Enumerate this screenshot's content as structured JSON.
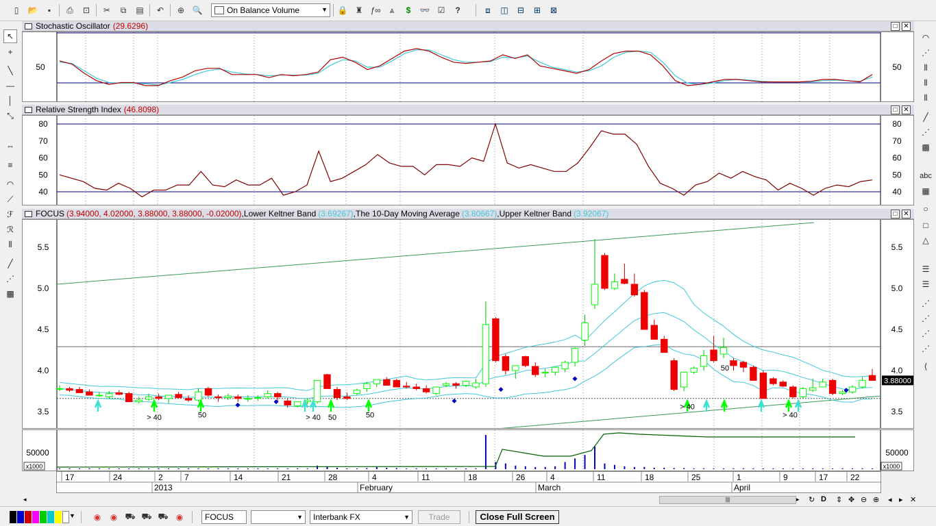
{
  "toolbar": {
    "indicator_selected": "On Balance Volume",
    "icons": [
      "new-icon",
      "open-icon",
      "save-icon",
      "print-icon",
      "print-preview-icon",
      "cut-icon",
      "copy-icon",
      "paste-icon",
      "undo-icon",
      "crosshair-icon",
      "zoom-icon",
      "indicator-icon",
      "expert-icon",
      "function-icon",
      "chart-icon",
      "dollar-icon",
      "binoculars-icon",
      "properties-icon",
      "help-icon",
      "window-cascade-icon",
      "tile-vertical-icon",
      "tile-horizontal-icon",
      "tile-grid-icon",
      "layout-icon"
    ]
  },
  "panes": {
    "stochastic": {
      "name": "Stochastic Oscillator",
      "value": "(29.6296)",
      "y_labels": [
        "50"
      ],
      "y_label_right": "50"
    },
    "rsi": {
      "name": "Relative Strength Index",
      "value": "(46.8098)",
      "y_labels": [
        "80",
        "70",
        "60",
        "50",
        "40"
      ]
    },
    "price": {
      "symbol": "FOCUS",
      "ohlc": "(3.94000, 4.02000, 3.88000, 3.88000, -0.02000)",
      "lower_band_label": "Lower Keltner Band",
      "lower_band_value": "(3.69267)",
      "ma_label": "The 10-Day Moving Average",
      "ma_value": "(3.80667)",
      "upper_band_label": "Upper Keltner Band",
      "upper_band_value": "(3.92067)",
      "sep1": ", ",
      "sep2": ", ",
      "y_labels": [
        "5.5",
        "5.0",
        "4.5",
        "4.0",
        "3.5"
      ],
      "last_price": "3.88000",
      "annotations": [
        "> 40",
        "50",
        "> 40",
        "50",
        "50",
        "> 40",
        "50",
        "> 40"
      ]
    },
    "volume": {
      "y_label": "50000",
      "multiplier": "x1000"
    }
  },
  "date_axis": {
    "days": [
      "17",
      "24",
      "2",
      "7",
      "14",
      "21",
      "28",
      "4",
      "11",
      "18",
      "26",
      "4",
      "11",
      "18",
      "25",
      "1",
      "9",
      "17",
      "22"
    ],
    "months": [
      "2013",
      "February",
      "March",
      "April"
    ]
  },
  "bottom_bar": {
    "symbol": "FOCUS",
    "period": "",
    "data_source": "Interbank FX",
    "trade_label": "Trade",
    "close_full_screen": "Close Full Screen"
  },
  "colors": {
    "candle_up": "#00ff00",
    "candle_down": "#ee0000",
    "band": "#40c8d8",
    "stoch_k": "#b00000",
    "stoch_d": "#40c8d8",
    "rsi": "#800000",
    "trendline": "#3a9a5a",
    "volume": "#0000c0",
    "obv": "#006000"
  },
  "chart_data": [
    {
      "type": "line",
      "title": "Stochastic Oscillator",
      "series": [
        {
          "name": "Stochastic Oscillator",
          "values": [
            60,
            55,
            40,
            28,
            22,
            25,
            25,
            20,
            20,
            28,
            34,
            44,
            48,
            48,
            38,
            38,
            38,
            33,
            38,
            36,
            38,
            42,
            62,
            66,
            58,
            46,
            52,
            64,
            76,
            80,
            76,
            66,
            58,
            56,
            58,
            60,
            70,
            64,
            70,
            52,
            48,
            44,
            40,
            46,
            60,
            72,
            76,
            76,
            70,
            52,
            28,
            20,
            22,
            26,
            30,
            30,
            28,
            26,
            26,
            26,
            26,
            27,
            30,
            30,
            28,
            26,
            38
          ]
        },
        {
          "name": "%D",
          "values": [
            58,
            56,
            44,
            32,
            25,
            24,
            24,
            23,
            21,
            25,
            30,
            38,
            44,
            47,
            42,
            39,
            38,
            36,
            37,
            37,
            37,
            40,
            53,
            62,
            60,
            50,
            50,
            60,
            72,
            78,
            78,
            70,
            62,
            58,
            58,
            59,
            66,
            65,
            68,
            58,
            50,
            46,
            42,
            44,
            52,
            66,
            74,
            76,
            74,
            58,
            36,
            24,
            22,
            24,
            28,
            30,
            29,
            27,
            26,
            26,
            26,
            26,
            28,
            29,
            28,
            27,
            34
          ]
        }
      ]
    },
    {
      "type": "line",
      "title": "Relative Strength Index",
      "ylim": [
        36,
        82
      ],
      "series": [
        {
          "name": "Relative Strength Index",
          "values": [
            50,
            48,
            46,
            42,
            41,
            45,
            42,
            37,
            41,
            41,
            44,
            44,
            52,
            44,
            43,
            47,
            44,
            44,
            48,
            38,
            40,
            44,
            64,
            46,
            48,
            52,
            56,
            62,
            57,
            55,
            55,
            50,
            56,
            56,
            55,
            60,
            58,
            80,
            57,
            54,
            56,
            54,
            52,
            52,
            57,
            66,
            76,
            74,
            74,
            68,
            55,
            45,
            42,
            38,
            44,
            46,
            51,
            48,
            52,
            49,
            47,
            41,
            45,
            42,
            38,
            42,
            44,
            43,
            46,
            47
          ]
        }
      ]
    },
    {
      "type": "candlestick",
      "title": "FOCUS",
      "ylim": [
        3.25,
        5.8
      ],
      "series": [
        {
          "name": "FOCUS",
          "values": [
            [
              3.78,
              3.82,
              3.75,
              3.78
            ],
            [
              3.78,
              3.8,
              3.74,
              3.76
            ],
            [
              3.77,
              3.8,
              3.73,
              3.73
            ],
            [
              3.74,
              3.77,
              3.7,
              3.7
            ],
            [
              3.7,
              3.74,
              3.68,
              3.7
            ],
            [
              3.68,
              3.75,
              3.66,
              3.72
            ],
            [
              3.73,
              3.76,
              3.7,
              3.71
            ],
            [
              3.72,
              3.74,
              3.62,
              3.62
            ],
            [
              3.62,
              3.68,
              3.6,
              3.64
            ],
            [
              3.65,
              3.72,
              3.63,
              3.68
            ],
            [
              3.68,
              3.72,
              3.64,
              3.66
            ],
            [
              3.66,
              3.7,
              3.6,
              3.7
            ],
            [
              3.71,
              3.74,
              3.66,
              3.67
            ],
            [
              3.66,
              3.7,
              3.62,
              3.64
            ],
            [
              3.64,
              3.78,
              3.62,
              3.74
            ],
            [
              3.78,
              3.8,
              3.68,
              3.7
            ],
            [
              3.68,
              3.71,
              3.62,
              3.67
            ],
            [
              3.67,
              3.72,
              3.64,
              3.69
            ],
            [
              3.68,
              3.71,
              3.62,
              3.66
            ],
            [
              3.66,
              3.7,
              3.62,
              3.66
            ],
            [
              3.67,
              3.7,
              3.63,
              3.67
            ],
            [
              3.68,
              3.76,
              3.66,
              3.72
            ],
            [
              3.72,
              3.74,
              3.62,
              3.68
            ],
            [
              3.63,
              3.66,
              3.55,
              3.58
            ],
            [
              3.57,
              3.62,
              3.55,
              3.62
            ],
            [
              3.62,
              3.66,
              3.59,
              3.64
            ],
            [
              3.62,
              3.88,
              3.6,
              3.88
            ],
            [
              3.95,
              3.96,
              3.78,
              3.78
            ],
            [
              3.77,
              3.8,
              3.64,
              3.67
            ],
            [
              3.68,
              3.73,
              3.64,
              3.66
            ],
            [
              3.72,
              3.78,
              3.7,
              3.76
            ],
            [
              3.78,
              3.86,
              3.74,
              3.84
            ],
            [
              3.84,
              3.89,
              3.8,
              3.89
            ],
            [
              3.89,
              3.92,
              3.82,
              3.82
            ],
            [
              3.88,
              3.9,
              3.8,
              3.8
            ],
            [
              3.81,
              3.86,
              3.78,
              3.8
            ],
            [
              3.8,
              3.84,
              3.76,
              3.78
            ],
            [
              3.78,
              3.82,
              3.72,
              3.74
            ],
            [
              3.72,
              3.8,
              3.7,
              3.8
            ],
            [
              3.82,
              3.86,
              3.8,
              3.84
            ],
            [
              3.84,
              3.86,
              3.78,
              3.82
            ],
            [
              3.82,
              3.88,
              3.8,
              3.87
            ],
            [
              3.8,
              3.9,
              3.78,
              3.85
            ],
            [
              3.84,
              4.84,
              3.8,
              4.56
            ],
            [
              4.63,
              4.65,
              4.1,
              4.12
            ],
            [
              4.17,
              4.2,
              3.95,
              4.0
            ],
            [
              4.0,
              4.05,
              3.9,
              4.06
            ],
            [
              4.17,
              4.18,
              4.04,
              4.06
            ],
            [
              4.05,
              4.1,
              3.92,
              3.95
            ],
            [
              3.97,
              4.02,
              3.92,
              3.98
            ],
            [
              3.98,
              4.04,
              3.94,
              4.04
            ],
            [
              4.02,
              4.12,
              3.98,
              4.1
            ],
            [
              4.1,
              4.28,
              4.05,
              4.27
            ],
            [
              4.37,
              4.68,
              4.3,
              4.58
            ],
            [
              4.8,
              5.6,
              4.75,
              5.05
            ],
            [
              5.4,
              5.43,
              4.98,
              5.0
            ],
            [
              5.0,
              5.18,
              4.98,
              5.08
            ],
            [
              5.11,
              5.3,
              5.05,
              5.06
            ],
            [
              5.05,
              5.18,
              4.9,
              4.92
            ],
            [
              4.95,
              4.98,
              4.5,
              4.5
            ],
            [
              4.55,
              4.62,
              4.38,
              4.38
            ],
            [
              4.38,
              4.42,
              4.22,
              4.22
            ],
            [
              4.12,
              4.15,
              3.75,
              3.77
            ],
            [
              3.8,
              3.98,
              3.75,
              3.98
            ],
            [
              3.98,
              4.05,
              3.96,
              4.03
            ],
            [
              4.05,
              4.25,
              4.0,
              4.18
            ],
            [
              4.25,
              4.42,
              4.1,
              4.12
            ],
            [
              4.2,
              4.4,
              4.15,
              4.28
            ],
            [
              4.12,
              4.15,
              4.0,
              4.06
            ],
            [
              4.1,
              4.12,
              3.98,
              4.04
            ],
            [
              4.04,
              4.06,
              3.92,
              3.88
            ],
            [
              3.97,
              4.0,
              3.7,
              3.66
            ],
            [
              3.9,
              3.92,
              3.82,
              3.84
            ],
            [
              3.86,
              3.88,
              3.8,
              3.81
            ],
            [
              3.8,
              3.82,
              3.66,
              3.68
            ],
            [
              3.68,
              3.8,
              3.66,
              3.78
            ],
            [
              3.76,
              3.9,
              3.74,
              3.79
            ],
            [
              3.8,
              3.9,
              3.8,
              3.86
            ],
            [
              3.88,
              3.9,
              3.7,
              3.72
            ],
            [
              3.72,
              3.76,
              3.7,
              3.74
            ],
            [
              3.74,
              3.82,
              3.72,
              3.8
            ],
            [
              3.8,
              3.92,
              3.78,
              3.88
            ],
            [
              3.94,
              4.02,
              3.88,
              3.88
            ]
          ]
        }
      ]
    },
    {
      "type": "bar",
      "title": "Volume",
      "series": [
        {
          "name": "Volume",
          "values": [
            1000,
            1000,
            1000,
            1000,
            1000,
            1000,
            1000,
            1000,
            1000,
            1000,
            1000,
            1000,
            1000,
            1000,
            1000,
            1000,
            1000,
            1000,
            1000,
            1000,
            1000,
            1000,
            1000,
            1000,
            1000,
            1000,
            5000,
            4000,
            2000,
            1000,
            1000,
            1500,
            3000,
            2000,
            1500,
            1000,
            1000,
            1000,
            1000,
            1000,
            1000,
            1000,
            1000,
            48000,
            10000,
            8000,
            5000,
            4000,
            3000,
            3000,
            4000,
            10000,
            15000,
            20000,
            32000,
            8000,
            6000,
            4000,
            3000,
            3000,
            2000,
            2000,
            1500,
            1500,
            1000,
            1000,
            1000,
            1000,
            1000,
            1000,
            1000,
            1000,
            1000,
            1000,
            1000,
            1000,
            1000,
            1000,
            1000,
            1000,
            1000,
            1000,
            1000
          ]
        }
      ]
    }
  ]
}
